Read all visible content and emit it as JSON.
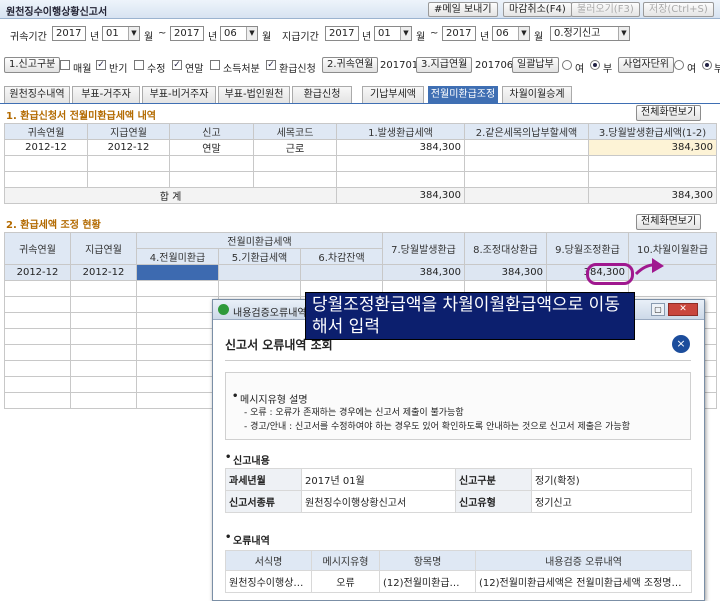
{
  "window": {
    "title": "원천징수이행상황신고서"
  },
  "toolbar": {
    "email": "#메일 보내기",
    "cancel_close": "마감취소(F4)",
    "load": "불러오기(F3)",
    "save": "저장(Ctrl+S)"
  },
  "filter": {
    "period_label": "귀속기간",
    "from_year": "2017",
    "from_month": "01",
    "to_year": "2017",
    "to_month": "06",
    "pay_label": "지급기간",
    "pay_from_year": "2017",
    "pay_from_month": "01",
    "pay_to_year": "2017",
    "pay_to_month": "06",
    "report_type": "0.정기신고",
    "unit_year": "년",
    "unit_month": "월",
    "tilde": "~"
  },
  "options": {
    "kind_btn": "1.신고구분",
    "monthly": "매월",
    "half": "반기",
    "amend": "수정",
    "yearend": "연말",
    "income": "소득처분",
    "refund": "환급신청",
    "accrual_btn": "2.귀속연월",
    "accrual_val": "201701",
    "paid_btn": "3.지급연월",
    "paid_val": "201706",
    "batch_btn": "일괄납부",
    "yes": "여",
    "no": "부",
    "biz_btn": "사업자단위",
    "yes2": "여",
    "no2": "부"
  },
  "tabs": [
    "원천징수내역",
    "부표-거주자",
    "부표-비거주자",
    "부표-법인원천",
    "환급신청",
    "기납부세액",
    "전월미환급조정",
    "차월이월승계"
  ],
  "section1": {
    "title": "1. 환급신청서 전월미환급세액 내역",
    "fullview": "전체화면보기",
    "headers": [
      "귀속연월",
      "지급연월",
      "신고",
      "세목코드",
      "1.발생환급세액",
      "2.같은세목의납부할세액",
      "3.당월발생환급세액(1-2)"
    ],
    "row": [
      "2012-12",
      "2012-12",
      "연말",
      "근로",
      "384,300",
      "",
      "384,300"
    ],
    "total_label": "합   계",
    "total_1": "384,300",
    "total_3": "384,300"
  },
  "section2": {
    "title": "2. 환급세액 조정 현황",
    "fullview": "전체화면보기",
    "group": "전월미환급세액",
    "headers": [
      "귀속연월",
      "지급연월",
      "4.전월미환급",
      "5.기환급세액",
      "6.차감잔액",
      "7.당월발생환급",
      "8.조정대상환급",
      "9.당월조정환급",
      "10.차월이월환급"
    ],
    "row": [
      "2012-12",
      "2012-12",
      "",
      "",
      "",
      "384,300",
      "384,300",
      "384,300",
      ""
    ]
  },
  "note": "당월조정환급액을 차월이월환급액으로 이동해서 입력",
  "dialog": {
    "caption": "내용검증오류내역",
    "title": "신고서 오류내역 조회",
    "close": "×",
    "msg_title": "메시지유형 설명",
    "msg1": "- 오류 : 오류가 존재하는 경우에는 신고서 제출이 불가능함",
    "msg2": "- 경고/안내 : 신고서를 수정하여야 하는 경우도 있어 확인하도록 안내하는 것으로 신고서 제출은 가능함",
    "report_section": "신고내용",
    "labels": {
      "period": "과세년월",
      "kind": "신고구분",
      "form": "신고서종류",
      "type": "신고유형"
    },
    "values": {
      "period": "2017년 01월",
      "kind": "정기(확정)",
      "form": "원천징수이행상황신고서",
      "type": "정기신고"
    },
    "error_section": "오류내역",
    "err_headers": [
      "서식명",
      "메시지유형",
      "항목명",
      "내용검증 오류내역"
    ],
    "err_row": [
      "원천징수이행상…",
      "오류",
      "(12)전월미환급…",
      "(12)전월미환급세액은 전월미환급세액 조정명…"
    ]
  },
  "colors": {
    "accent": "#3f6fb3",
    "section": "#b36a00",
    "note_bg": "#0c1f6e",
    "ring": "#a0188f"
  }
}
